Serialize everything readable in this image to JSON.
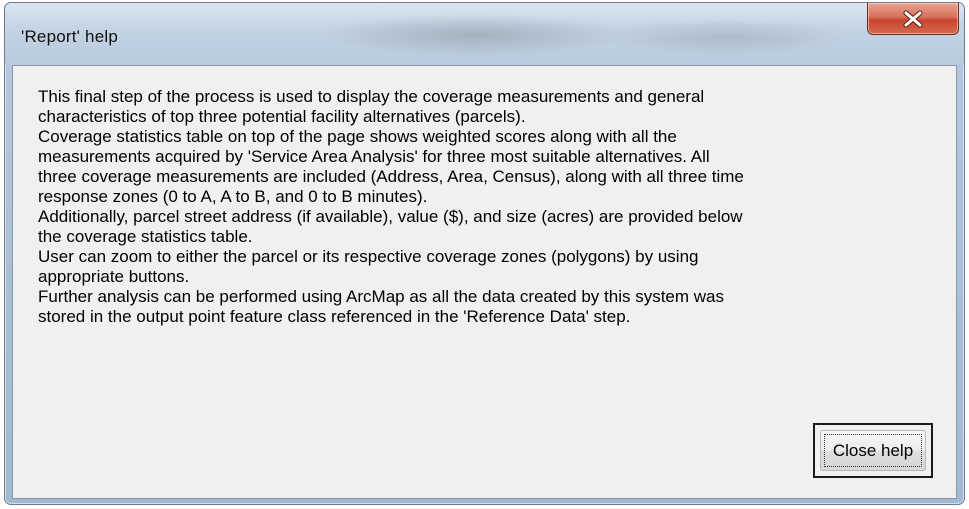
{
  "window": {
    "title": "'Report' help"
  },
  "titlebar": {
    "close_icon": "close-x-icon"
  },
  "help": {
    "lines": [
      "This final step of the process is used to display the coverage measurements and general",
      "characteristics of top three potential facility alternatives (parcels).",
      "Coverage statistics table on top of the page shows weighted scores along with all the",
      "measurements acquired by 'Service Area Analysis' for three most suitable alternatives. All",
      "three coverage measurements are included (Address, Area, Census), along with all three time",
      "response zones (0 to A, A to B, and 0 to B minutes).",
      "Additionally, parcel street address (if available), value ($), and size (acres) are provided below",
      "the coverage statistics table.",
      "User can zoom to either the parcel or its respective coverage zones (polygons) by using",
      "appropriate buttons.",
      "Further analysis can be performed using ArcMap as all the data created by this system was",
      "stored in the output point feature class referenced in the 'Reference Data' step."
    ]
  },
  "buttons": {
    "close_help_label": "Close help"
  },
  "colors": {
    "close_button": "#c8452f",
    "client_background": "#f0f0f0",
    "window_frame": "#a9bfd6"
  }
}
